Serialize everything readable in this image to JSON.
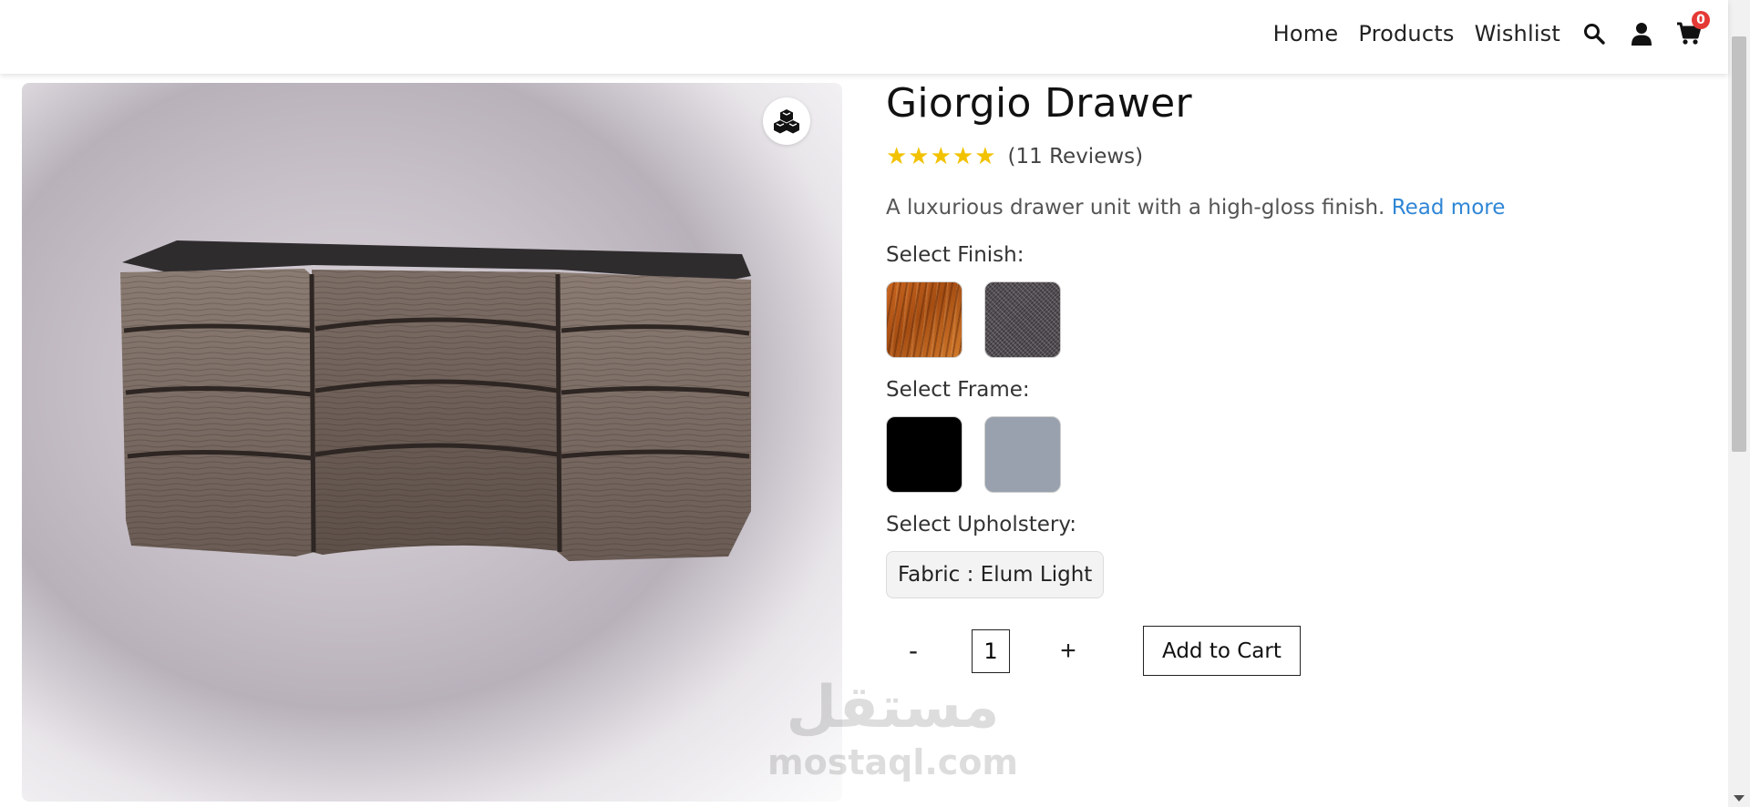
{
  "header": {
    "nav": [
      {
        "label": "Home"
      },
      {
        "label": "Products"
      },
      {
        "label": "Wishlist"
      }
    ],
    "icons": [
      "search-icon",
      "user-icon",
      "cart-icon"
    ],
    "cart_count": "0"
  },
  "product": {
    "title": "Giorgio Drawer",
    "stars": "★★★★★",
    "rating": 5,
    "reviews": "(11 Reviews)",
    "description": "A luxurious drawer unit with a high-gloss finish.",
    "read_more": "Read more"
  },
  "options": {
    "finish_label": "Select Finish:",
    "frame_label": "Select Frame:",
    "upholstery_label": "Select Upholstery:",
    "upholstery_value": "Fabric : Elum Light",
    "frame_colors": [
      "#000000",
      "#98a1ad"
    ]
  },
  "cart": {
    "minus": "-",
    "plus": "+",
    "quantity": "1",
    "add_label": "Add to Cart"
  },
  "watermark": {
    "arabic": "مستقل",
    "latin": "mostaql.com"
  },
  "colors": {
    "star": "#f2c200",
    "link": "#2f86d6",
    "badge": "#e53935"
  }
}
